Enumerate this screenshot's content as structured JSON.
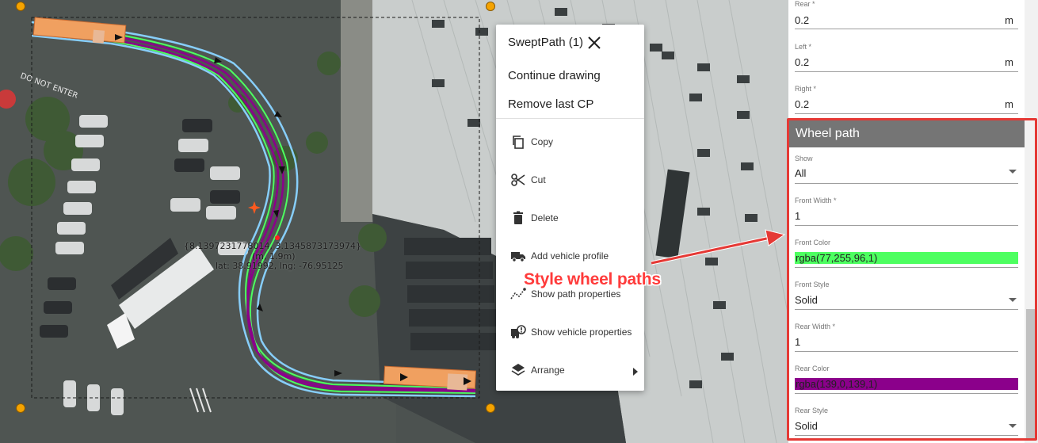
{
  "map": {
    "coordinate_label": {
      "line1": "{8.1397231778014, 3.1345873173974}",
      "line2": "(m, 1.9m)",
      "line3": "lat: 38.91992, lng: -76.95125"
    },
    "pavement_text": "DO NOT ENTER",
    "colors": {
      "front_path": "#4dff60",
      "rear_path": "#8b008b",
      "outline": "#87cefa",
      "vehicle": "#f0a060",
      "handle": "#f5a300"
    }
  },
  "context_menu": {
    "title": "SweptPath (1)",
    "close_icon": "close-icon",
    "continue_drawing": "Continue drawing",
    "remove_last_cp": "Remove last CP",
    "items": [
      {
        "label": "Copy",
        "icon": "copy-icon"
      },
      {
        "label": "Cut",
        "icon": "scissors-icon"
      },
      {
        "label": "Delete",
        "icon": "trash-icon"
      },
      {
        "label": "Add vehicle profile",
        "icon": "truck-icon"
      },
      {
        "label": "Show path properties",
        "icon": "path-icon"
      },
      {
        "label": "Show vehicle properties",
        "icon": "vehicle-info-icon"
      },
      {
        "label": "Arrange",
        "icon": "layers-icon"
      }
    ]
  },
  "annotation": {
    "text": "Style wheel paths",
    "color": "#ff3b3b"
  },
  "properties_panel": {
    "rear": {
      "label": "Rear *",
      "value": "0.2",
      "unit": "m"
    },
    "left": {
      "label": "Left *",
      "value": "0.2",
      "unit": "m"
    },
    "right": {
      "label": "Right *",
      "value": "0.2",
      "unit": "m"
    },
    "wheel_path": {
      "title": "Wheel path",
      "show": {
        "label": "Show",
        "value": "All"
      },
      "front_width": {
        "label": "Front Width *",
        "value": "1"
      },
      "front_color": {
        "label": "Front Color",
        "value": "rgba(77,255,96,1)",
        "color": "#4dff60"
      },
      "front_style": {
        "label": "Front Style",
        "value": "Solid"
      },
      "rear_width": {
        "label": "Rear Width *",
        "value": "1"
      },
      "rear_color": {
        "label": "Rear Color",
        "value": "rgba(139,0,139,1)",
        "color": "#8b008b"
      },
      "rear_style": {
        "label": "Rear Style",
        "value": "Solid"
      }
    }
  }
}
